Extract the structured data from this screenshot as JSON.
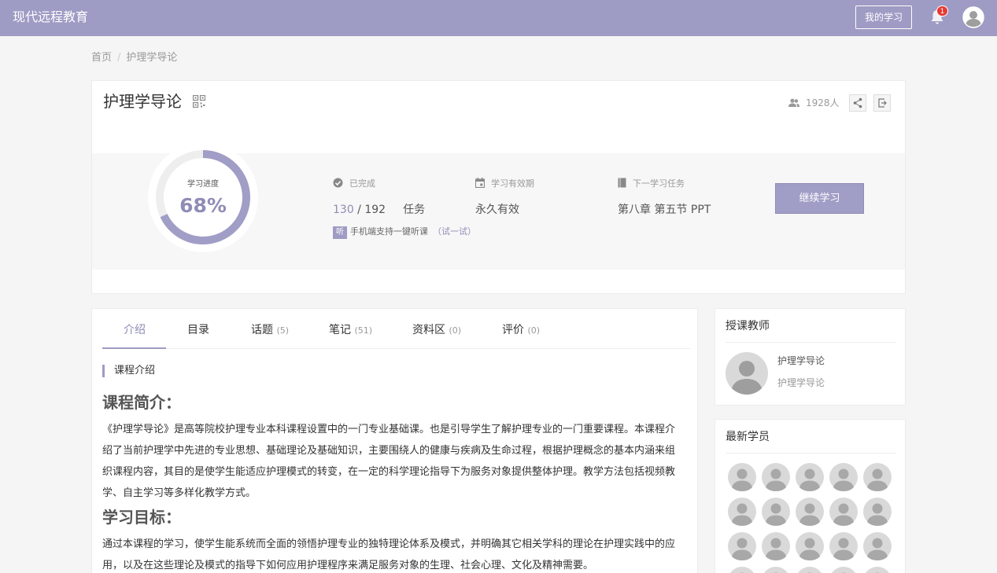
{
  "header": {
    "brand": "现代远程教育",
    "my_learning": "我的学习",
    "notification_count": "1"
  },
  "breadcrumb": {
    "home": "首页",
    "sep": "/",
    "current": "护理学导论"
  },
  "course": {
    "title": "护理学导论",
    "students": "1928人",
    "progress_label": "学习进度",
    "progress_value": "68%",
    "progress_fraction": 0.68,
    "completed_label": "已完成",
    "completed_done": "130",
    "completed_sep": " / ",
    "completed_total": "192",
    "completed_unit": "任务",
    "validity_label": "学习有效期",
    "validity_value": "永久有效",
    "next_label": "下一学习任务",
    "next_value": "第八章 第五节 PPT",
    "listen_tag": "听",
    "listen_text": "手机端支持一键听课",
    "listen_try": "（试一试）",
    "continue_button": "继续学习"
  },
  "tabs": [
    {
      "label": "介绍",
      "count": ""
    },
    {
      "label": "目录",
      "count": ""
    },
    {
      "label": "话题",
      "count": "(5)"
    },
    {
      "label": "笔记",
      "count": "(51)"
    },
    {
      "label": "资料区",
      "count": "(0)"
    },
    {
      "label": "评价",
      "count": "(0)"
    }
  ],
  "intro": {
    "section_title": "课程介绍",
    "heading1": "课程简介：",
    "paragraph1": "《护理学导论》是高等院校护理专业本科课程设置中的一门专业基础课。也是引导学生了解护理专业的一门重要课程。本课程介绍了当前护理学中先进的专业思想、基础理论及基础知识，主要围绕人的健康与疾病及生命过程，根据护理概念的基本内涵来组织课程内容，其目的是使学生能适应护理模式的转变，在一定的科学理论指导下为服务对象提供整体护理。教学方法包括视频教学、自主学习等多样化教学方式。",
    "heading2": "学习目标：",
    "paragraph2": "通过本课程的学习，使学生能系统而全面的领悟护理专业的独特理论体系及模式，并明确其它相关学科的理论在护理实践中的应用，以及在这些理论及模式的指导下如何应用护理程序来满足服务对象的生理、社会心理、文化及精神需要。"
  },
  "sidebar": {
    "teacher_title": "授课教师",
    "teacher_name": "护理学导论",
    "teacher_subtitle": "护理学导论",
    "students_title": "最新学员"
  },
  "colors": {
    "accent": "#9e9bc4",
    "accent_text": "#8f8cb6",
    "badge": "#e53935"
  },
  "icons": {
    "bell": "bell-icon",
    "avatar": "user-avatar-icon",
    "qr": "qrcode-icon",
    "students": "people-icon",
    "share": "share-icon",
    "exit": "exit-icon",
    "check": "check-circle-icon",
    "calendar": "calendar-icon",
    "book": "book-icon"
  }
}
